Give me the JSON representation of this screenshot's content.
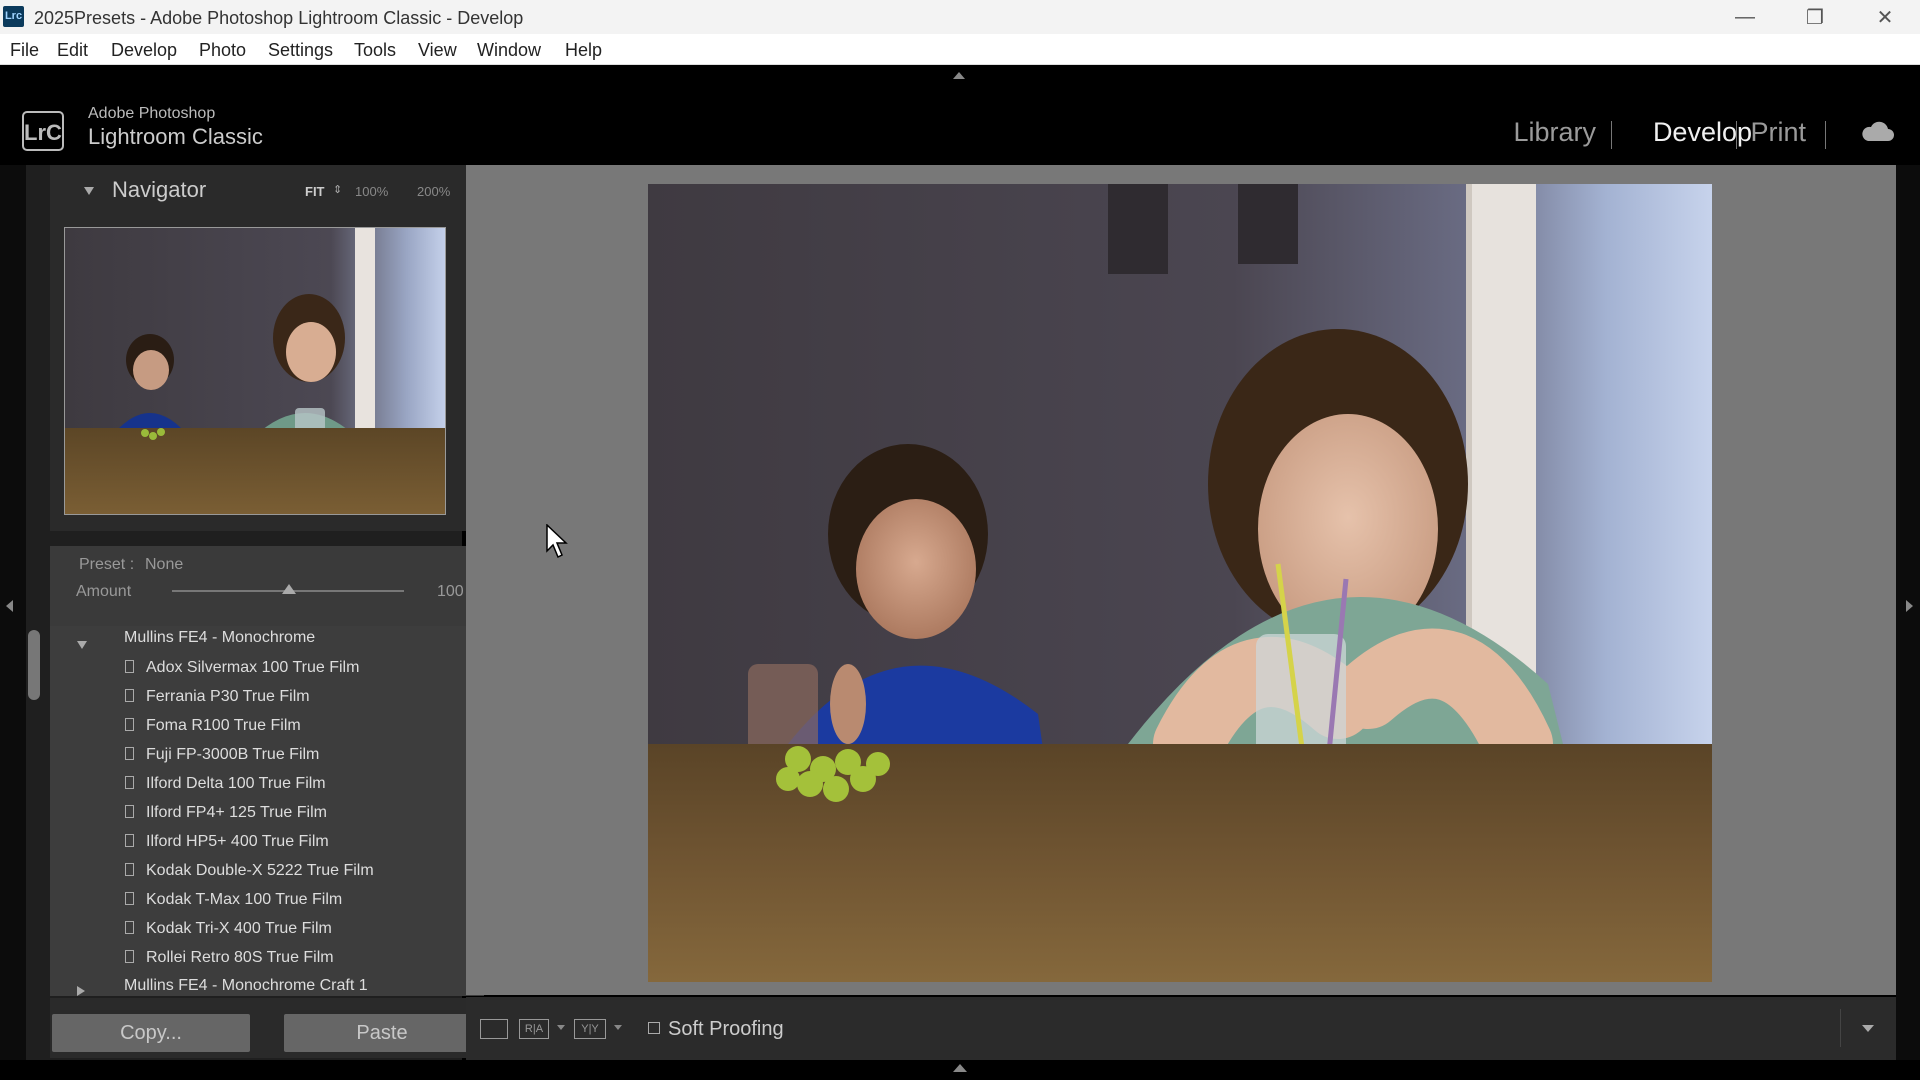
{
  "window": {
    "title": "2025Presets - Adobe Photoshop Lightroom Classic - Develop",
    "app_badge": "Lrc"
  },
  "menu": [
    "File",
    "Edit",
    "Develop",
    "Photo",
    "Settings",
    "Tools",
    "View",
    "Window",
    "Help"
  ],
  "brand": {
    "logo": "LrC",
    "line1": "Adobe Photoshop",
    "line2": "Lightroom Classic"
  },
  "modules": {
    "library": "Library",
    "develop": "Develop",
    "print": "Print",
    "active": "Develop"
  },
  "navigator": {
    "title": "Navigator",
    "zoom": [
      "FIT",
      "100%",
      "200%"
    ],
    "active_zoom": "FIT"
  },
  "preset_amount": {
    "preset_label": "Preset :",
    "preset_value": "None",
    "amount_label": "Amount",
    "amount_value": "100",
    "amount_level": 0.5
  },
  "presets": {
    "expanded_group": "Mullins FE4 - Monochrome",
    "items": [
      "Adox Silvermax 100 True Film",
      "Ferrania P30 True Film",
      "Foma R100 True Film",
      "Fuji FP-3000B True Film",
      "Ilford Delta 100 True Film",
      "Ilford FP4+ 125 True Film",
      "Ilford HP5+ 400 True Film",
      "Kodak Double-X 5222 True Film",
      "Kodak T-Max 100 True Film",
      "Kodak Tri-X 400 True Film",
      "Rollei Retro 80S True Film"
    ],
    "collapsed_group": "Mullins FE4 - Monochrome Craft 1"
  },
  "buttons": {
    "copy": "Copy...",
    "paste": "Paste"
  },
  "toolbar": {
    "soft_proofing": "Soft Proofing",
    "compare_icon_text": "R|A",
    "survey_icon_text": "Y|Y"
  },
  "colors": {
    "accent": "#f0f0f0",
    "panel": "#3d3d3d",
    "background": "#787878"
  }
}
